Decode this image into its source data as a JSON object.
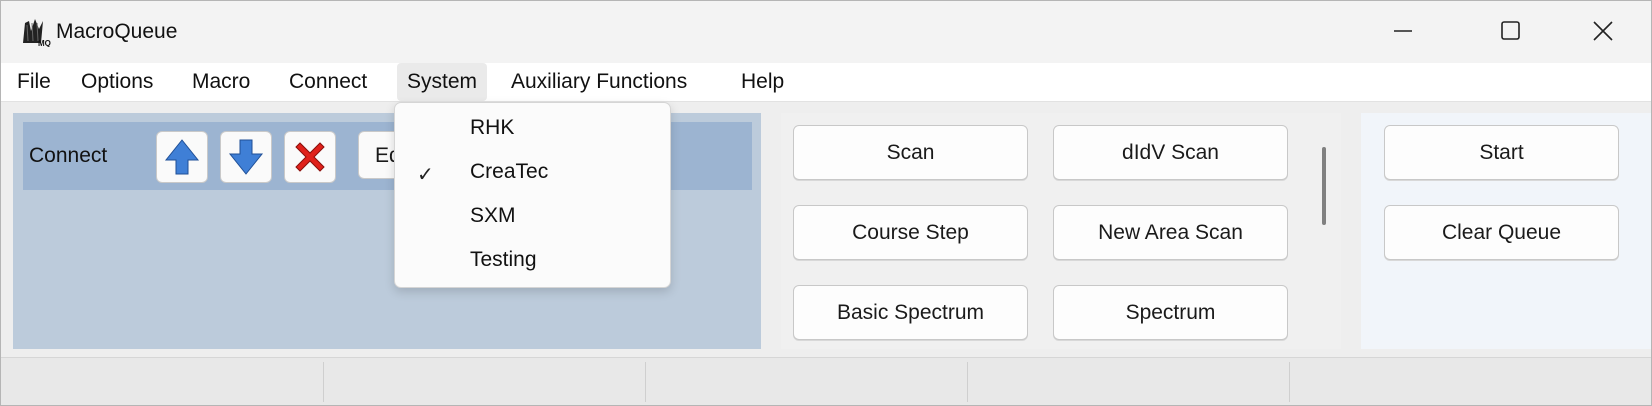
{
  "window": {
    "title": "MacroQueue",
    "app_icon_text": "MQ",
    "controls": [
      "minimize-icon",
      "maximize-icon",
      "close-icon"
    ]
  },
  "menubar": {
    "items": [
      "File",
      "Options",
      "Macro",
      "Connect",
      "System",
      "Auxiliary Functions",
      "Help"
    ],
    "open_menu": "System"
  },
  "system_menu": {
    "items": [
      {
        "label": "RHK",
        "checked": false
      },
      {
        "label": "CreaTec",
        "checked": true
      },
      {
        "label": "SXM",
        "checked": false
      },
      {
        "label": "Testing",
        "checked": false
      }
    ],
    "check_glyph": "✓"
  },
  "connect_panel": {
    "label": "Connect",
    "edit_text": "Ed",
    "icons": [
      "arrow-up-icon",
      "arrow-down-icon",
      "delete-x-icon"
    ]
  },
  "macro_buttons": [
    "Scan",
    "dIdV Scan",
    "Course Step",
    "New Area Scan",
    "Basic Spectrum",
    "Spectrum"
  ],
  "queue_buttons": [
    "Start",
    "Clear Queue"
  ],
  "colors": {
    "connect_bar": "#9cb4d1",
    "left_panel": "#bccbdb",
    "right_panel": "#f1f5fa",
    "arrow_blue": "#3f7fd6",
    "delete_red": "#e0211b"
  }
}
